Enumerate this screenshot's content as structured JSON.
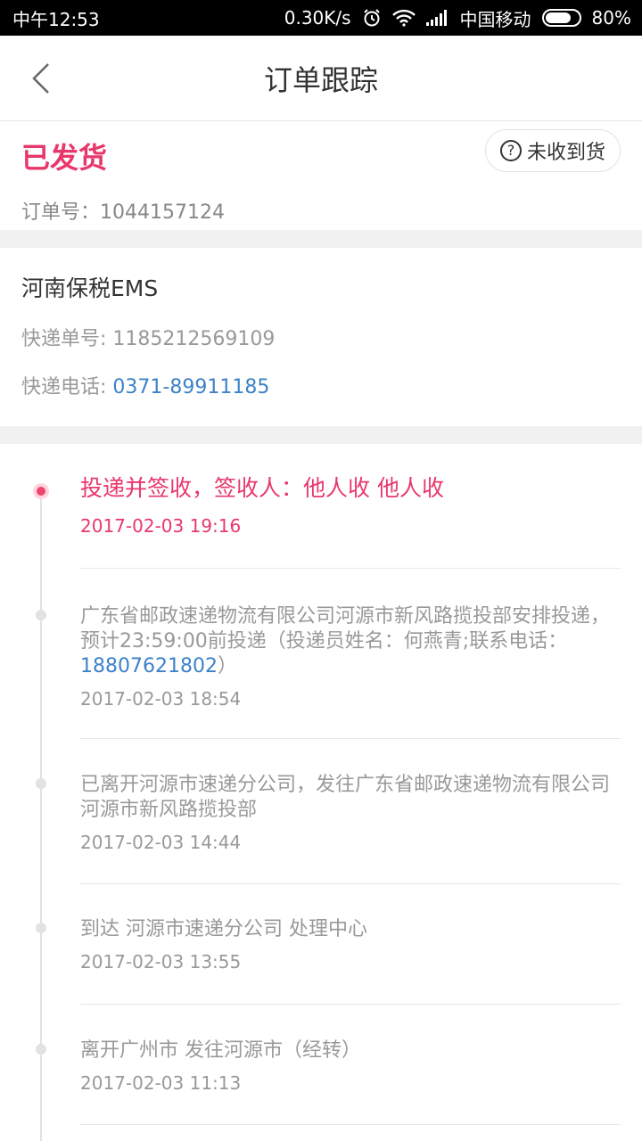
{
  "status_bar": {
    "time": "中午12:53",
    "speed": "0.30K/s",
    "carrier": "中国移动",
    "battery": "80%",
    "battery_level": 0.8
  },
  "header": {
    "title": "订单跟踪",
    "back_icon": "chevron-left-icon"
  },
  "order": {
    "status": "已发货",
    "order_no_label": "订单号：",
    "order_no": "1044157124",
    "not_received_label": "未收到货",
    "accent_color": "#e8386b"
  },
  "courier": {
    "name": "河南保税EMS",
    "tracking_label": "快递单号: ",
    "tracking_no": "1185212569109",
    "phone_label": "快递电话: ",
    "phone": "0371-89911185"
  },
  "timeline": [
    {
      "desc": "投递并签收，签收人：他人收 他人收",
      "time": "2017-02-03 19:16",
      "active": true
    },
    {
      "desc_before": "广东省邮政速递物流有限公司河源市新风路揽投部安排投递，预计23:59:00前投递（投递员姓名：何燕青;联系电话：",
      "phone": "18807621802",
      "desc_after": "）",
      "time": "2017-02-03 18:54",
      "active": false
    },
    {
      "desc": "已离开河源市速递分公司，发往广东省邮政速递物流有限公司河源市新风路揽投部",
      "time": "2017-02-03 14:44",
      "active": false
    },
    {
      "desc": "到达  河源市速递分公司 处理中心",
      "time": "2017-02-03 13:55",
      "active": false
    },
    {
      "desc": "离开广州市 发往河源市（经转）",
      "time": "2017-02-03 11:13",
      "active": false
    }
  ]
}
